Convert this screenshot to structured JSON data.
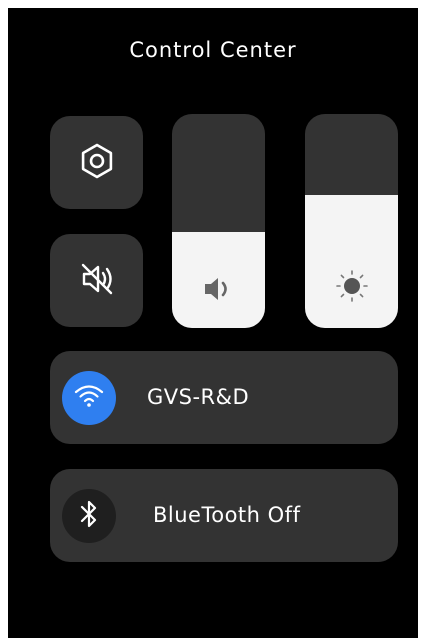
{
  "header": {
    "title": "Control Center"
  },
  "tiles": {
    "settings": {
      "icon": "hexagon-settings-icon"
    },
    "mute": {
      "icon": "speaker-muted-icon"
    }
  },
  "sliders": {
    "volume": {
      "icon": "speaker-volume-icon",
      "level": 0.45
    },
    "brightness": {
      "icon": "sun-brightness-icon",
      "level": 0.62
    }
  },
  "wifi": {
    "icon": "wifi-icon",
    "network_name": "GVS-R&D",
    "accent": "#2f7ff0"
  },
  "bluetooth": {
    "icon": "bluetooth-icon",
    "status_label": "BlueTooth Off"
  },
  "colors": {
    "background": "#000000",
    "tile": "#333333",
    "slider_fill": "#f4f4f4",
    "text": "#ffffff"
  }
}
